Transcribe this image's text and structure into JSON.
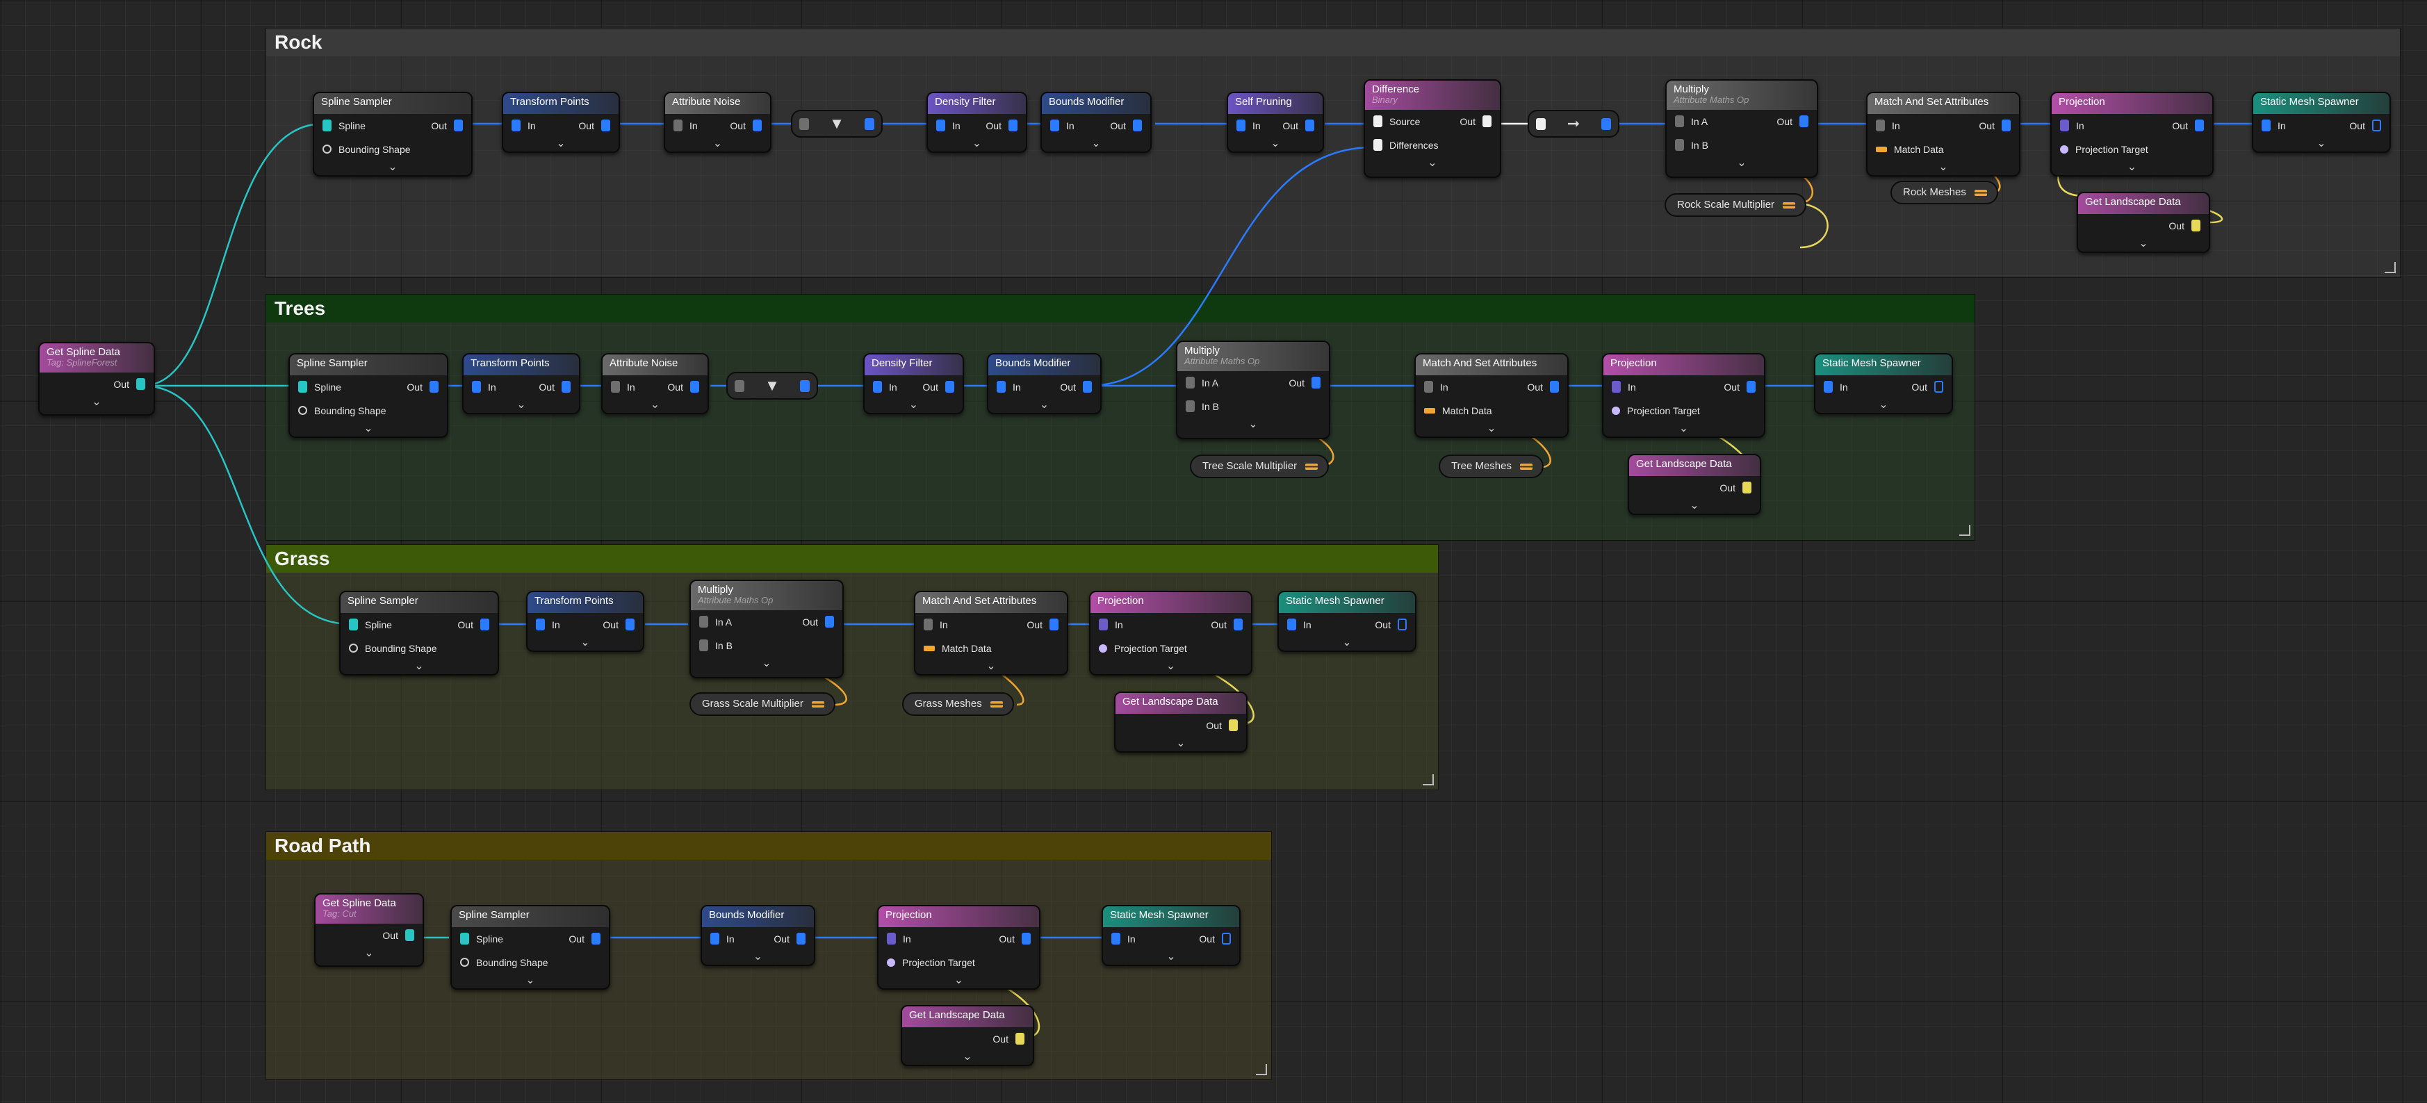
{
  "colors": {
    "spline_pin": "#29c4c4",
    "point_pin": "#2a7bff",
    "param_pin": "#f2a632",
    "landscape_pin": "#e8d85a",
    "header_purple": "#6b54c4",
    "header_blue": "#2e4a8a",
    "header_gray": "#6a6a6a",
    "header_pink": "#b34ea8",
    "header_teal": "#1b8f7e",
    "header_magenta": "#a34b9c"
  },
  "get_spline_data_main": {
    "title": "Get Spline Data",
    "tag": "Tag: SplineForest",
    "out": "Out"
  },
  "groups": {
    "rock": "Rock",
    "trees": "Trees",
    "grass": "Grass",
    "road_path": "Road Path"
  },
  "labels": {
    "spline_sampler": "Spline Sampler",
    "spline": "Spline",
    "bounding_shape": "Bounding Shape",
    "out": "Out",
    "in": "In",
    "transform_points": "Transform Points",
    "attribute_noise": "Attribute Noise",
    "density_filter": "Density Filter",
    "bounds_modifier": "Bounds Modifier",
    "self_pruning": "Self Pruning",
    "difference": "Difference",
    "binary": "Binary",
    "source": "Source",
    "differences": "Differences",
    "multiply": "Multiply",
    "attribute_maths_op": "Attribute Maths Op",
    "in_a": "In A",
    "in_b": "In B",
    "match_and_set": "Match And Set Attributes",
    "match_data": "Match Data",
    "projection": "Projection",
    "projection_target": "Projection Target",
    "static_mesh_spawner": "Static Mesh Spawner",
    "get_landscape_data": "Get Landscape Data",
    "get_spline_data": "Get Spline Data",
    "tag_cut": "Tag: Cut",
    "expand": "⌄"
  },
  "params": {
    "rock_scale": "Rock Scale Multiplier",
    "rock_meshes": "Rock Meshes",
    "tree_scale": "Tree Scale Multiplier",
    "tree_meshes": "Tree Meshes",
    "grass_scale": "Grass Scale Multiplier",
    "grass_meshes": "Grass Meshes"
  },
  "icons": {
    "filter": "filter-icon",
    "arrow": "arrow-right-icon",
    "expand": "chevron-down-icon"
  }
}
